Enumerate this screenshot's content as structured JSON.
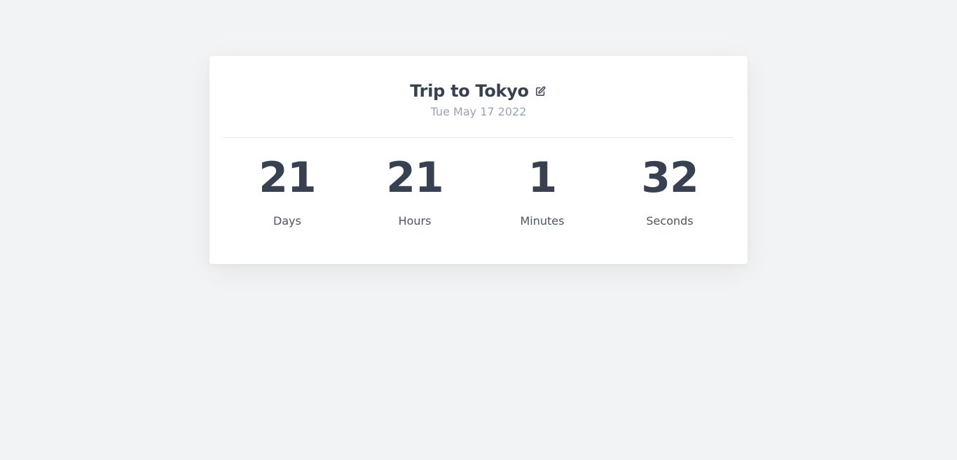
{
  "event": {
    "title": "Trip to Tokyo",
    "date": "Tue May 17 2022",
    "edit_icon": "edit-icon"
  },
  "countdown": [
    {
      "value": "21",
      "label": "Days"
    },
    {
      "value": "21",
      "label": "Hours"
    },
    {
      "value": "1",
      "label": "Minutes"
    },
    {
      "value": "32",
      "label": "Seconds"
    }
  ],
  "colors": {
    "background": "#f2f3f5",
    "card": "#ffffff",
    "text": "#374151",
    "muted": "#9ca3af"
  }
}
